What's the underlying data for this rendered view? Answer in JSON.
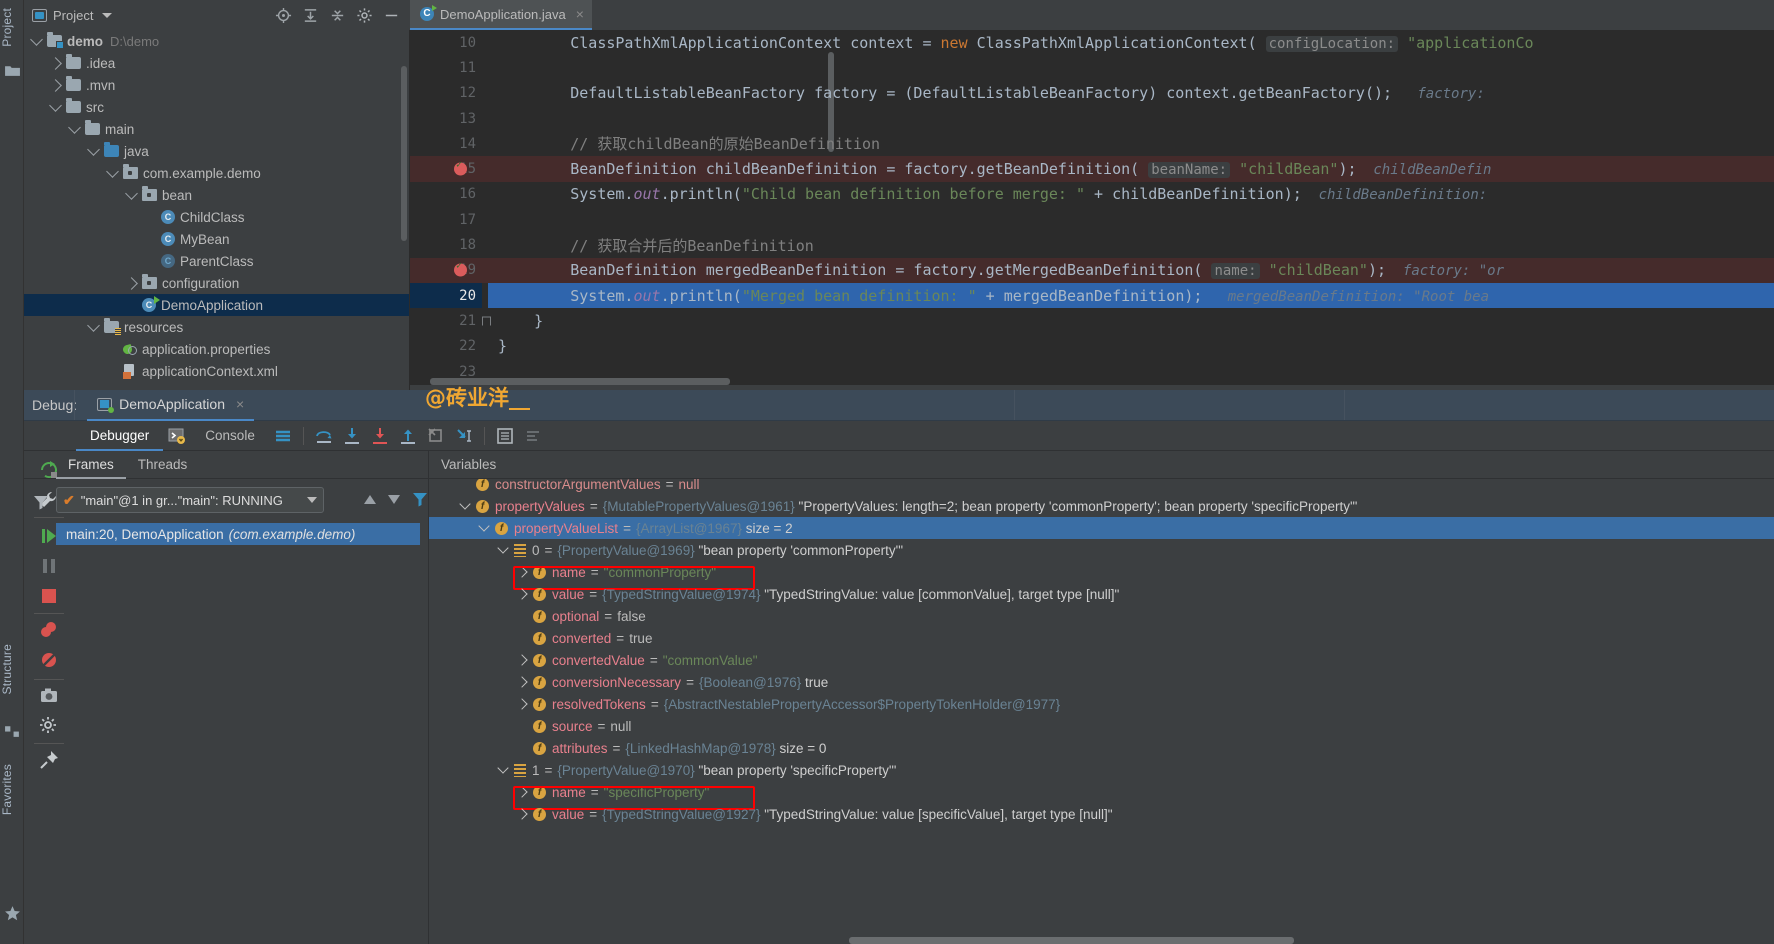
{
  "window": {
    "left_strip": {
      "project_label": "Project",
      "structure_label": "Structure",
      "favorites_label": "Favorites"
    }
  },
  "project_panel": {
    "title": "Project",
    "toolbar_icons": [
      "locate-icon",
      "expand-all-icon",
      "collapse-all-icon",
      "gear-icon",
      "minimize-icon"
    ],
    "tree": [
      {
        "depth": 0,
        "label": "demo",
        "suffix": "D:\\demo",
        "icon": "module-folder-icon",
        "arrow": "down",
        "bold": true
      },
      {
        "depth": 1,
        "label": ".idea",
        "suffix": "",
        "icon": "folder-icon",
        "arrow": "right",
        "bold": false
      },
      {
        "depth": 1,
        "label": ".mvn",
        "suffix": "",
        "icon": "folder-icon",
        "arrow": "right",
        "bold": false
      },
      {
        "depth": 1,
        "label": "src",
        "suffix": "",
        "icon": "folder-icon",
        "arrow": "down",
        "bold": false
      },
      {
        "depth": 2,
        "label": "main",
        "suffix": "",
        "icon": "folder-icon",
        "arrow": "down",
        "bold": false
      },
      {
        "depth": 3,
        "label": "java",
        "suffix": "",
        "icon": "source-folder-icon",
        "arrow": "down",
        "bold": false
      },
      {
        "depth": 4,
        "label": "com.example.demo",
        "suffix": "",
        "icon": "package-icon",
        "arrow": "down",
        "bold": false
      },
      {
        "depth": 5,
        "label": "bean",
        "suffix": "",
        "icon": "package-icon",
        "arrow": "down",
        "bold": false
      },
      {
        "depth": 6,
        "label": "ChildClass",
        "suffix": "",
        "icon": "java-class-icon",
        "arrow": "none",
        "bold": false
      },
      {
        "depth": 6,
        "label": "MyBean",
        "suffix": "",
        "icon": "java-class-icon",
        "arrow": "none",
        "bold": false
      },
      {
        "depth": 6,
        "label": "ParentClass",
        "suffix": "",
        "icon": "java-abstract-class-icon",
        "arrow": "none",
        "bold": false
      },
      {
        "depth": 5,
        "label": "configuration",
        "suffix": "",
        "icon": "package-icon",
        "arrow": "right",
        "bold": false
      },
      {
        "depth": 5,
        "label": "DemoApplication",
        "suffix": "",
        "icon": "java-runnable-class-icon",
        "arrow": "none",
        "bold": false,
        "selected": true
      },
      {
        "depth": 3,
        "label": "resources",
        "suffix": "",
        "icon": "resources-folder-icon",
        "arrow": "down",
        "bold": false
      },
      {
        "depth": 4,
        "label": "application.properties",
        "suffix": "",
        "icon": "spring-properties-icon",
        "arrow": "none",
        "bold": false
      },
      {
        "depth": 4,
        "label": "applicationContext.xml",
        "suffix": "",
        "icon": "spring-xml-icon",
        "arrow": "none",
        "bold": false
      }
    ]
  },
  "editor": {
    "tab": {
      "label": "DemoApplication.java",
      "icon": "java-runnable-class-icon",
      "close": "×"
    },
    "lines": [
      {
        "n": 10,
        "state": "normal",
        "segs": [
          {
            "t": "        ",
            "c": "p"
          },
          {
            "t": "ClassPathXmlApplicationContext context = ",
            "c": "p"
          },
          {
            "t": "new ",
            "c": "kw"
          },
          {
            "t": "ClassPathXmlApplicationContext( ",
            "c": "p"
          },
          {
            "t": "configLocation:",
            "c": "hint"
          },
          {
            "t": " ",
            "c": "p"
          },
          {
            "t": "\"applicationCo",
            "c": "str"
          }
        ]
      },
      {
        "n": 11,
        "state": "normal",
        "segs": []
      },
      {
        "n": 12,
        "state": "normal",
        "segs": [
          {
            "t": "        ",
            "c": "p"
          },
          {
            "t": "DefaultListableBeanFactory factory = (DefaultListableBeanFactory) context.getBeanFactory();",
            "c": "p"
          },
          {
            "t": "   factory: ",
            "c": "inlay"
          }
        ]
      },
      {
        "n": 13,
        "state": "normal",
        "segs": []
      },
      {
        "n": 14,
        "state": "normal",
        "segs": [
          {
            "t": "        ",
            "c": "p"
          },
          {
            "t": "// 获取childBean的原始BeanDefinition",
            "c": "cmt"
          }
        ]
      },
      {
        "n": 15,
        "state": "breakpoint",
        "segs": [
          {
            "t": "        ",
            "c": "p"
          },
          {
            "t": "BeanDefinition childBeanDefinition = factory.getBeanDefinition( ",
            "c": "p"
          },
          {
            "t": "beanName:",
            "c": "hint"
          },
          {
            "t": " ",
            "c": "p"
          },
          {
            "t": "\"childBean\"",
            "c": "str"
          },
          {
            "t": ");",
            "c": "p"
          },
          {
            "t": "  childBeanDefin",
            "c": "inlay"
          }
        ]
      },
      {
        "n": 16,
        "state": "normal",
        "segs": [
          {
            "t": "        ",
            "c": "p"
          },
          {
            "t": "System.",
            "c": "p"
          },
          {
            "t": "out",
            "c": "fld"
          },
          {
            "t": ".println(",
            "c": "p"
          },
          {
            "t": "\"Child bean definition before merge: \"",
            "c": "str"
          },
          {
            "t": " + childBeanDefinition);",
            "c": "p"
          },
          {
            "t": "  childBeanDefinition:",
            "c": "inlay"
          }
        ]
      },
      {
        "n": 17,
        "state": "normal",
        "segs": []
      },
      {
        "n": 18,
        "state": "normal",
        "segs": [
          {
            "t": "        ",
            "c": "p"
          },
          {
            "t": "// 获取合并后的BeanDefinition",
            "c": "cmt"
          }
        ]
      },
      {
        "n": 19,
        "state": "breakpoint",
        "segs": [
          {
            "t": "        ",
            "c": "p"
          },
          {
            "t": "BeanDefinition mergedBeanDefinition = factory.getMergedBeanDefinition( ",
            "c": "p"
          },
          {
            "t": "name:",
            "c": "hint"
          },
          {
            "t": " ",
            "c": "p"
          },
          {
            "t": "\"childBean\"",
            "c": "str"
          },
          {
            "t": ");",
            "c": "p"
          },
          {
            "t": "  factory: \"or",
            "c": "inlay"
          }
        ]
      },
      {
        "n": 20,
        "state": "current",
        "segs": [
          {
            "t": "        ",
            "c": "p"
          },
          {
            "t": "System.",
            "c": "p"
          },
          {
            "t": "out",
            "c": "fld"
          },
          {
            "t": ".println(",
            "c": "p"
          },
          {
            "t": "\"Merged bean definition: \"",
            "c": "str"
          },
          {
            "t": " + mergedBeanDefinition);",
            "c": "p"
          },
          {
            "t": "   mergedBeanDefinition: \"Root bea",
            "c": "inlay"
          }
        ]
      },
      {
        "n": 21,
        "state": "normal",
        "segs": [
          {
            "t": "    }",
            "c": "p"
          }
        ],
        "fold": true
      },
      {
        "n": 22,
        "state": "normal",
        "segs": [
          {
            "t": "}",
            "c": "p"
          }
        ]
      },
      {
        "n": 23,
        "state": "normal",
        "segs": []
      }
    ]
  },
  "watermark": "@砖业洋__",
  "debug": {
    "label": "Debug:",
    "session_tab": "DemoApplication",
    "session_close": "×",
    "tabs": [
      {
        "label": "Debugger",
        "active": true,
        "icon": ""
      },
      {
        "label": "Console",
        "active": false,
        "icon": "console-icon"
      }
    ],
    "toolbar_icons": [
      "layout-icon",
      "step-over-icon",
      "step-into-icon",
      "force-step-into-icon",
      "step-out-icon",
      "drop-frame-icon",
      "run-to-cursor-icon",
      "evaluate-icon",
      "settings-list-icon"
    ],
    "side_icons": [
      "rerun-icon",
      "settings-wrench-icon",
      "resume-icon",
      "pause-icon",
      "stop-icon",
      "mute-breakpoints-icon",
      "view-breakpoints-icon",
      "camera-icon",
      "gear-icon",
      "pin-icon"
    ],
    "frames_panel": {
      "tabs": [
        {
          "label": "Frames",
          "active": true
        },
        {
          "label": "Threads",
          "active": false
        }
      ],
      "thread_selector": "\"main\"@1 in gr...\"main\": RUNNING",
      "frames": [
        {
          "label": "main:20, DemoApplication",
          "package": "(com.example.demo)",
          "selected": true
        }
      ]
    },
    "variables_panel": {
      "title": "Variables",
      "rows": [
        {
          "indent": 1,
          "arrow": "none",
          "icon": "field-icon",
          "name": "constructorArgumentValues",
          "eq": "=",
          "value": "null",
          "value_class": "vred",
          "name_class": "vred",
          "clipped_top": true
        },
        {
          "indent": 1,
          "arrow": "down",
          "icon": "field-icon",
          "name": "propertyValues",
          "eq": "=",
          "type": "{MutablePropertyValues@1961}",
          "desc": "\"PropertyValues: length=2; bean property 'commonProperty'; bean property 'specificProperty'\""
        },
        {
          "indent": 2,
          "arrow": "down",
          "icon": "field-icon",
          "name": "propertyValueList",
          "eq": "=",
          "type": "{ArrayList@1967}",
          "desc": "size = 2",
          "selected": true
        },
        {
          "indent": 3,
          "arrow": "down",
          "icon": "list-item-icon",
          "name": "0",
          "eq": "=",
          "type": "{PropertyValue@1969}",
          "desc": "\"bean property 'commonProperty'\"",
          "name_class": "vlit"
        },
        {
          "indent": 4,
          "arrow": "right",
          "icon": "field-icon",
          "name": "name",
          "eq": "=",
          "value": "\"commonProperty\"",
          "value_class": "vstr",
          "highlight": true
        },
        {
          "indent": 4,
          "arrow": "right",
          "icon": "field-icon",
          "name": "value",
          "eq": "=",
          "type": "{TypedStringValue@1974}",
          "desc": "\"TypedStringValue: value [commonValue], target type [null]\""
        },
        {
          "indent": 4,
          "arrow": "none",
          "icon": "field-icon",
          "name": "optional",
          "eq": "=",
          "value": "false",
          "value_class": "vlit"
        },
        {
          "indent": 4,
          "arrow": "none",
          "icon": "field-icon",
          "name": "converted",
          "eq": "=",
          "value": "true",
          "value_class": "vlit"
        },
        {
          "indent": 4,
          "arrow": "right",
          "icon": "field-icon",
          "name": "convertedValue",
          "eq": "=",
          "value": "\"commonValue\"",
          "value_class": "vstr"
        },
        {
          "indent": 4,
          "arrow": "right",
          "icon": "field-icon",
          "name": "conversionNecessary",
          "eq": "=",
          "type": "{Boolean@1976}",
          "desc": "true"
        },
        {
          "indent": 4,
          "arrow": "right",
          "icon": "field-icon",
          "name": "resolvedTokens",
          "eq": "=",
          "type": "{AbstractNestablePropertyAccessor$PropertyTokenHolder@1977}",
          "desc": ""
        },
        {
          "indent": 4,
          "arrow": "none",
          "icon": "field-icon",
          "name": "source",
          "eq": "=",
          "value": "null",
          "value_class": "vlit"
        },
        {
          "indent": 4,
          "arrow": "none",
          "icon": "field-icon",
          "name": "attributes",
          "eq": "=",
          "type": "{LinkedHashMap@1978}",
          "desc": "size = 0"
        },
        {
          "indent": 3,
          "arrow": "down",
          "icon": "list-item-icon",
          "name": "1",
          "eq": "=",
          "type": "{PropertyValue@1970}",
          "desc": "\"bean property 'specificProperty'\"",
          "name_class": "vlit"
        },
        {
          "indent": 4,
          "arrow": "right",
          "icon": "field-icon",
          "name": "name",
          "eq": "=",
          "value": "\"specificProperty\"",
          "value_class": "vstr",
          "highlight": true
        },
        {
          "indent": 4,
          "arrow": "right",
          "icon": "field-icon",
          "name": "value",
          "eq": "=",
          "type": "{TypedStringValue@1927}",
          "desc": "\"TypedStringValue: value [specificValue], target type [null]\""
        }
      ]
    }
  },
  "colors": {
    "accent": "#4a88c7",
    "selection": "#3a6ea5",
    "editor_bg": "#2b2b2b",
    "panel_bg": "#3c3f41",
    "breakpoint_line": "#452b2b",
    "current_line": "#2f65ad",
    "highlight_box": "#ff0000",
    "string": "#6a8759",
    "keyword": "#cc7832",
    "watermark": "#f0a732"
  }
}
